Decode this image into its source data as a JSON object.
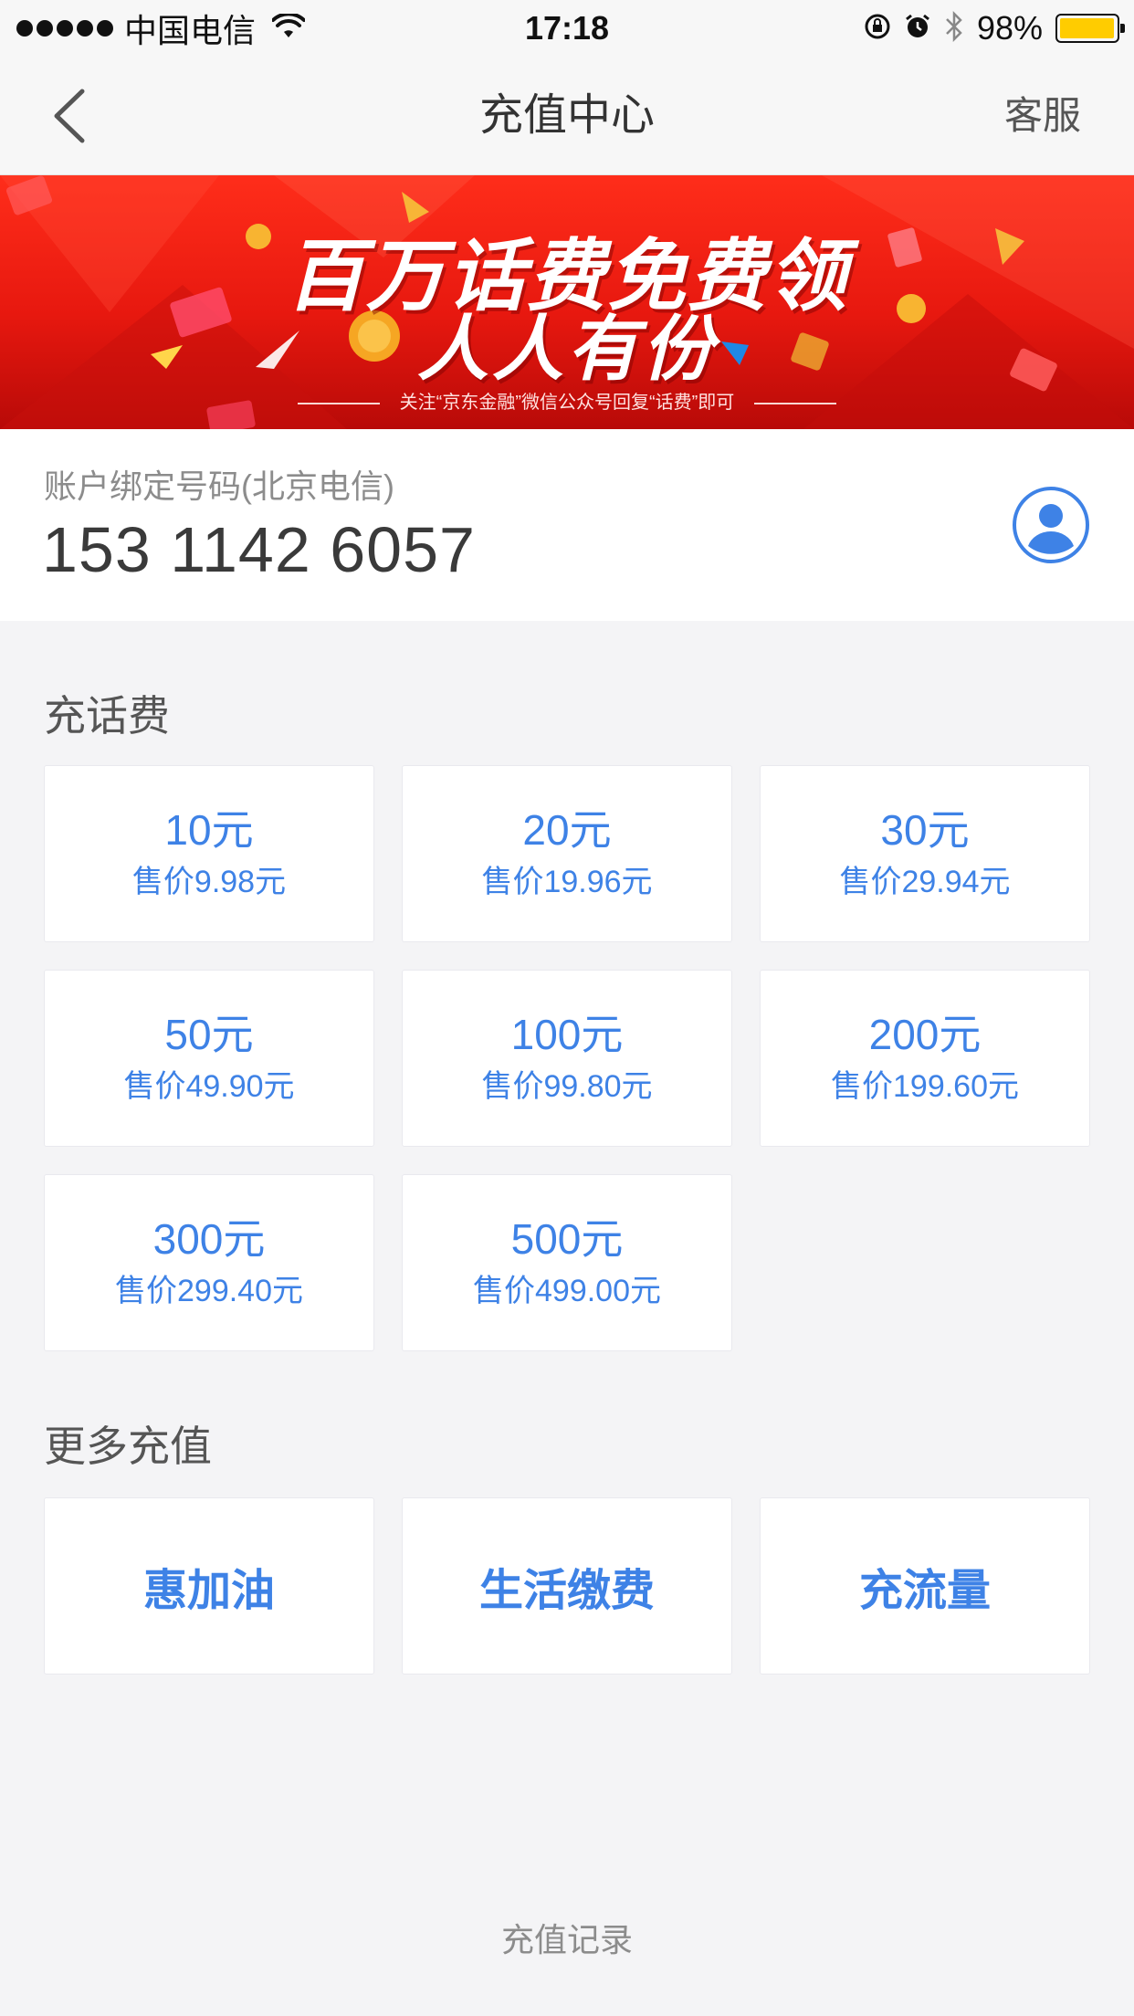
{
  "status_bar": {
    "carrier": "中国电信",
    "time": "17:18",
    "battery_percent": "98%",
    "battery_level": 0.98,
    "icons": [
      "signal-dots-icon",
      "wifi-icon",
      "rotation-lock-icon",
      "alarm-icon",
      "bluetooth-icon",
      "battery-icon"
    ]
  },
  "nav": {
    "title": "充值中心",
    "service_label": "客服",
    "back_icon": "chevron-left-icon"
  },
  "banner": {
    "headline": "百万话费免费领",
    "subheadline": "人人有份",
    "note": "关注“京东金融”微信公众号回复“话费”即可"
  },
  "account": {
    "label": "账户绑定号码(北京电信)",
    "phone": "153 1142 6057",
    "contact_icon": "contact-person-icon"
  },
  "recharge": {
    "title": "充话费",
    "options": [
      {
        "amount": "10元",
        "price": "售价9.98元"
      },
      {
        "amount": "20元",
        "price": "售价19.96元"
      },
      {
        "amount": "30元",
        "price": "售价29.94元"
      },
      {
        "amount": "50元",
        "price": "售价49.90元"
      },
      {
        "amount": "100元",
        "price": "售价99.80元"
      },
      {
        "amount": "200元",
        "price": "售价199.60元"
      },
      {
        "amount": "300元",
        "price": "售价299.40元"
      },
      {
        "amount": "500元",
        "price": "售价499.00元"
      }
    ]
  },
  "more": {
    "title": "更多充值",
    "items": [
      {
        "label": "惠加油"
      },
      {
        "label": "生活缴费"
      },
      {
        "label": "充流量"
      }
    ]
  },
  "footer": {
    "history_label": "充值记录"
  },
  "colors": {
    "accent_blue": "#3e82e6",
    "banner_red": "#e7180f",
    "battery_yellow": "#ffcc00",
    "page_bg": "#f4f4f6"
  }
}
